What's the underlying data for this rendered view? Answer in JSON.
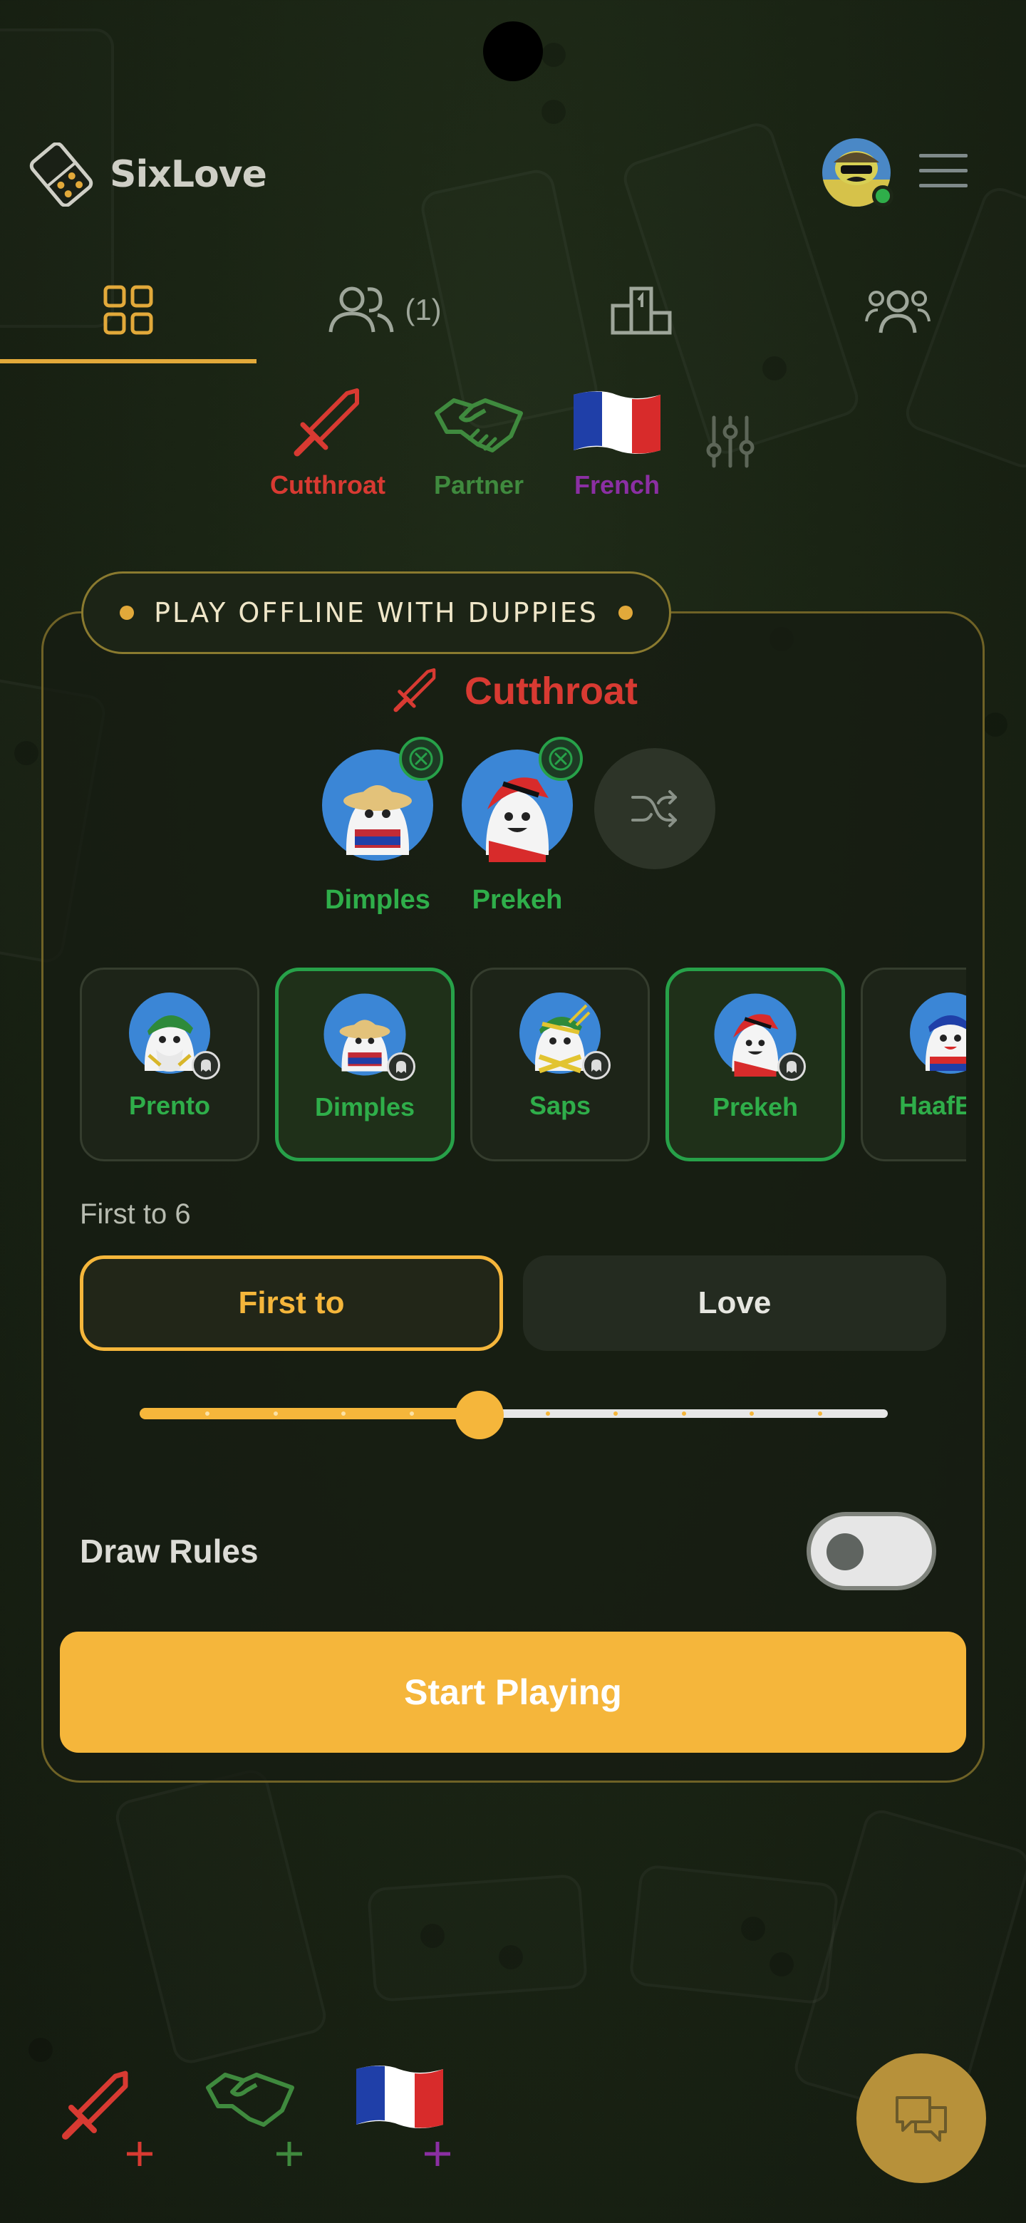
{
  "app": {
    "name": "SixLove"
  },
  "tabs": [
    {
      "icon": "grid-icon",
      "label": ""
    },
    {
      "icon": "friends-icon",
      "count": "(1)"
    },
    {
      "icon": "leaderboard-icon",
      "label": ""
    },
    {
      "icon": "groups-icon",
      "label": ""
    }
  ],
  "modes": {
    "cutthroat": "Cutthroat",
    "partner": "Partner",
    "french": "French"
  },
  "card": {
    "pill_text": "PLAY OFFLINE WITH DUPPIES",
    "mode_title": "Cutthroat",
    "selected_players": [
      "Dimples",
      "Prekeh"
    ],
    "roster": [
      {
        "name": "Prento",
        "selected": false
      },
      {
        "name": "Dimples",
        "selected": true
      },
      {
        "name": "Saps",
        "selected": false
      },
      {
        "name": "Prekeh",
        "selected": true
      },
      {
        "name": "HaafEed",
        "selected": false
      }
    ],
    "score_label": "First to 6",
    "segment": {
      "first_to": "First to",
      "love": "Love",
      "active": "first_to"
    },
    "slider": {
      "value": 6,
      "min": 1,
      "max": 12
    },
    "draw_rules_label": "Draw Rules",
    "draw_rules_enabled": false,
    "start_button": "Start Playing"
  },
  "colors": {
    "accent": "#f5b63b",
    "cutthroat": "#d83a32",
    "partner": "#3f8a3e",
    "french": "#8b2fa3",
    "selected_green": "#27a149"
  }
}
